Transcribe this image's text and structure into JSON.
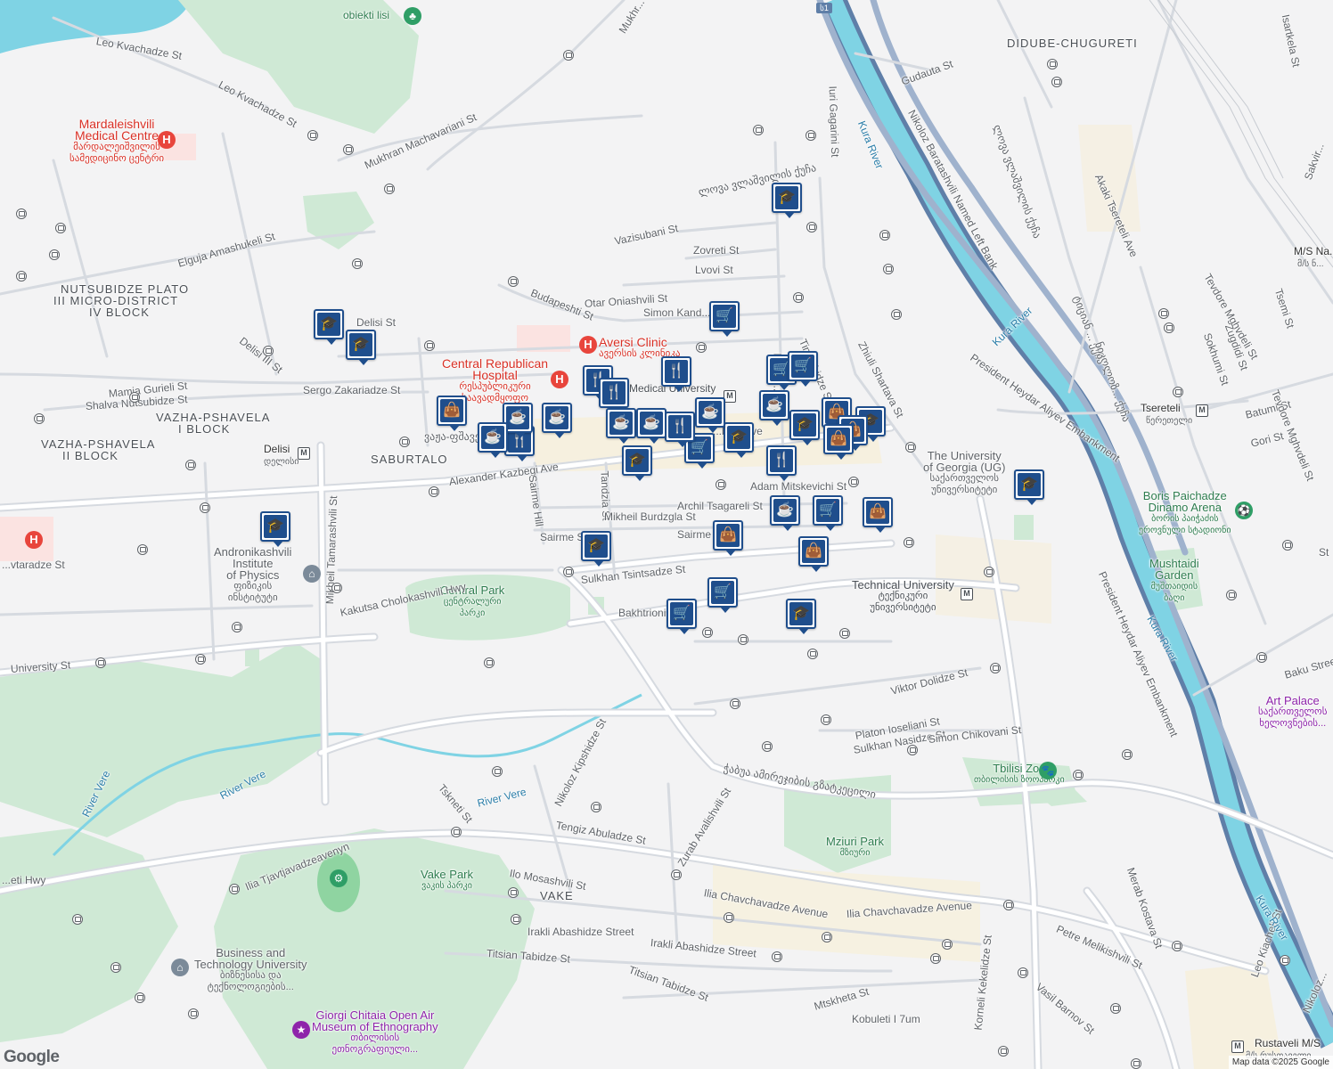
{
  "map": {
    "attribution": "Map data ©2025 Google",
    "logo": "Google",
    "colors": {
      "background": "#f3f3f4",
      "road": "#ffffff",
      "road_outline": "#d6dae0",
      "park": "#cfe9d5",
      "river": "#7fd3e4",
      "highway": "#8ea5c4",
      "pin": "#1f4e8c",
      "hospital": "#e8453c",
      "zoo": "#2f9e66"
    },
    "districts": [
      {
        "id": "didube",
        "text": "DIDUBE-CHUGURETI"
      },
      {
        "id": "nutsubidze1",
        "text": "NUTSUBIDZE PLATO"
      },
      {
        "id": "nutsubidze2",
        "text": "III MICRO-DISTRICT"
      },
      {
        "id": "nutsubidze3",
        "text": "IV BLOCK"
      },
      {
        "id": "vazha1a",
        "text": "VAZHA-PSHAVELA"
      },
      {
        "id": "vazha1b",
        "text": "I BLOCK"
      },
      {
        "id": "vazha2a",
        "text": "VAZHA-PSHAVELA"
      },
      {
        "id": "vazha2b",
        "text": "II BLOCK"
      },
      {
        "id": "saburtalo",
        "text": "SABURTALO"
      },
      {
        "id": "vake",
        "text": "VAKE"
      }
    ],
    "places": {
      "mardaleishvili": {
        "name": "Mardaleishvili",
        "name2": "Medical Centre",
        "local": "მარდალეიშვილის",
        "local2": "სამედიცინო ცენტრი"
      },
      "aversi": {
        "name": "Aversi Clinic",
        "local": "ავერსის კლინიკა"
      },
      "central_republican": {
        "name": "Central Republican",
        "name2": "Hospital",
        "local": "რესპუბლიკური",
        "local2": "საავადმყოფო"
      },
      "andronikashvili": {
        "name": "Andronikashvili",
        "name2": "Institute",
        "name3": "of Physics",
        "local": "ფიზიკის",
        "local2": "ინსტიტუტი"
      },
      "central_park": {
        "name": "Central Park",
        "local": "ცენტრალური",
        "local2": "პარკი"
      },
      "technical_university": {
        "name": "Technical University",
        "local": "ტექნიკური",
        "local2": "უნივერსიტეტი"
      },
      "university_georgia": {
        "name": "The University",
        "name2": "of Georgia (UG)",
        "local": "საქართველოს",
        "local2": "უნივერსიტეტი"
      },
      "dinamo": {
        "name": "Boris Paichadze",
        "name2": "Dinamo Arena",
        "local": "ბორის პაიჭაძის",
        "local2": "ეროვნული სტადიონი"
      },
      "mushtaidi": {
        "name": "Mushtaidi",
        "name2": "Garden",
        "local": "მუშთაიდის",
        "local2": "ბაღი"
      },
      "art_palace": {
        "name": "Art Palace",
        "local": "საქართველოს",
        "local2": "ხელოვნების..."
      },
      "zoo": {
        "name": "Tbilisi Zoo",
        "local": "თბილისის ზოოპარკი"
      },
      "mziuri": {
        "name": "Mziuri Park",
        "local": "მზიური"
      },
      "vake_park": {
        "name": "Vake Park",
        "local": "ვაკის პარკი"
      },
      "business_tech": {
        "name": "Business and",
        "name2": "Technology University",
        "local": "ბიზნესისა და",
        "local2": "ტექნოლოგიების..."
      },
      "chitaia": {
        "name": "Giorgi Chitaia Open Air",
        "name2": "Museum of Ethnography",
        "local": "თბილისის",
        "local2": "ეთნოგრაფიული..."
      },
      "obiekti": {
        "name": "obiekti lisi"
      },
      "medical_uni": {
        "name": "Medical University",
        "local": "სამედიცინო",
        "local2": "უნივერსიტეტი"
      }
    },
    "streets": {
      "leo_kvachadze_1": "Leo Kvachadze St",
      "leo_kvachadze_2": "Leo Kvachadze St",
      "mukhrani": "Mukhr...",
      "machavariani": "Mukhran Machavariani St",
      "amashukeli": "Elguja Amashukeli St",
      "delisi": "Delisi St",
      "delisi3": "Delisi III St",
      "mamia": "Mamia Gurieli St",
      "shalva": "Shalva Nutsubidze St",
      "sergo": "Sergo Zakariadze St",
      "budapeshti": "Budapeshti St",
      "otar": "Otar Oniashvili St",
      "vazisubani": "Vazisubani St",
      "zovreti": "Zovreti St",
      "lvovi": "Lvovi St",
      "simon": "Simon Kand...",
      "pekini": "Pekini...",
      "gagarini": "Iuri Gagarini St",
      "gudauta": "Gudauta St",
      "zhiuli": "Zhiuli Shartava St",
      "tin": "Tin...ebidze St",
      "kazbegi": "Alexander Kazbegi Ave",
      "kazbegi2": "...begi Ave",
      "vazha_ave": "ვაჟა-ფშაველა...",
      "tandzia": "Tandzia St",
      "sairme_hill": "Sairme Hill",
      "archil": "Archil Tsagareli St",
      "mitskevichi": "Adam Mitskevichi St",
      "burdzgla": "Mikheil Burdzgla St",
      "sairme1": "Sairme St",
      "sairme2": "Sairme S...",
      "tsintsadze": "Sulkhan Tsintsadze St",
      "bakhtrioni": "Bakhtrioni...",
      "chokoshvili": "Kakutsa Cholokashvili Hwy",
      "tamarashvili": "Mikheil Tamarashvili St",
      "university": "University St",
      "tvtaradze": "...vtaradze St",
      "dolidze": "Viktor Dolidze St",
      "ioseliani": "Platon Ioseliani St",
      "nasidze": "Sulkhan Nasidze St",
      "chikovani": "Simon Chikovani St",
      "amirejibi": "ჭაბუა ამირეჯიბის გზატკეცილი",
      "kipshidze": "Nikoloz Kipshidze St",
      "tskneti": "Tskneti St",
      "abuladze": "Tengiz Abuladze St",
      "avalishvili": "Zurab Avalishvili St",
      "tjavjavadze": "Ilia Tjavtjavadzeavenyn",
      "mosashvili": "Ilo Mosashvili St",
      "chavchavadze1": "Ilia Chavchavadze Avenue",
      "chavchavadze2": "Ilia Chavchavadze Avenue",
      "abashidze1": "Irakli Abashidze Street",
      "abashidze2": "Irakli Abashidze Street",
      "titsian1": "Titsian Tabidze St",
      "titsian2": "Titsian Tabidze St",
      "mtskheta": "Mtskheta St",
      "kobuleti": "Kobuleti I 7um",
      "kekelidze": "Korneli Kekelidze St",
      "barnov": "Vasil Barnov St",
      "melikishvili": "Petre Melikishvili St",
      "kostava": "Merab Kostava St",
      "kiacheli": "Leo Kiacheli St",
      "rustaveli": "Rustaveli M/S",
      "rustaveli_local": "მ/ს რუსთაველი",
      "left_bank": "Nikoloz Baratashvili Named Left Bank",
      "aliyev1": "President Heydar Aliyev Embankment",
      "aliyev2": "President Heydar Aliyev Embankment",
      "nikoloz_right": "Nikoloz...",
      "tsereteli_ave": "Akaki Tsereteli Ave",
      "tsereteli": "Tsereteli",
      "tsereteli_local": "წერეთელი",
      "delisi_metro": "Delisi",
      "delisi_metro_local": "დელისი",
      "batumi": "Batumi St",
      "gori": "Gori St",
      "tevdore1": "Tevdore Mghvdeli St",
      "tevdore2": "Tevdore Mghvdeli St",
      "tsemi": "Tsemi St",
      "zugdidi": "Zugdidi St",
      "sokhumi": "Sokhumi St",
      "baku": "Baku Street",
      "sakvire": "Sakvir...",
      "isartkela": "Isartkela St",
      "ms_na": "M/S Na...",
      "ms_na_local": "მ/ს ნ...",
      "geo_street1": "ლოვა ვლაშვილის ქუჩა",
      "geo_street2": "ლოვა ვლაშვილის ქუჩა",
      "geo_street3": "ტიციან ... ქუჩა",
      "geo_street4": "ნიკოლოზ... ქუჩა",
      "river_hwy": "...eti Hwy",
      "st_right": "St"
    },
    "rivers": {
      "kura1": "Kura River",
      "kura2": "Kura River",
      "kura3": "Kura River",
      "kura4": "Kura River",
      "vere1": "River Vere",
      "vere2": "River Vere",
      "vere3": "River Vere"
    },
    "highway_shield": "ს1",
    "hospital_glyph": "H",
    "metro_glyph": "M",
    "pins": [
      {
        "icon": "graduation-cap-icon",
        "glyph": "🎓"
      },
      {
        "icon": "graduation-cap-icon",
        "glyph": "🎓"
      },
      {
        "icon": "graduation-cap-icon",
        "glyph": "🎓"
      },
      {
        "icon": "graduation-cap-icon",
        "glyph": "🎓"
      },
      {
        "icon": "graduation-cap-icon",
        "glyph": "🎓"
      },
      {
        "icon": "graduation-cap-icon",
        "glyph": "🎓"
      },
      {
        "icon": "graduation-cap-icon",
        "glyph": "🎓"
      },
      {
        "icon": "graduation-cap-icon",
        "glyph": "🎓"
      },
      {
        "icon": "graduation-cap-icon",
        "glyph": "🎓"
      },
      {
        "icon": "graduation-cap-icon",
        "glyph": "🎓"
      },
      {
        "icon": "graduation-cap-icon",
        "glyph": "🎓"
      },
      {
        "icon": "shopping-cart-icon",
        "glyph": "🛒"
      },
      {
        "icon": "shopping-cart-icon",
        "glyph": "🛒"
      },
      {
        "icon": "shopping-cart-icon",
        "glyph": "🛒"
      },
      {
        "icon": "shopping-cart-icon",
        "glyph": "🛒"
      },
      {
        "icon": "shopping-cart-icon",
        "glyph": "🛒"
      },
      {
        "icon": "shopping-cart-icon",
        "glyph": "🛒"
      },
      {
        "icon": "shopping-cart-icon",
        "glyph": "🛒"
      },
      {
        "icon": "cutlery-icon",
        "glyph": "🍴"
      },
      {
        "icon": "cutlery-icon",
        "glyph": "🍴"
      },
      {
        "icon": "cutlery-icon",
        "glyph": "🍴"
      },
      {
        "icon": "cutlery-icon",
        "glyph": "🍴"
      },
      {
        "icon": "cutlery-icon",
        "glyph": "🍴"
      },
      {
        "icon": "cutlery-icon",
        "glyph": "🍴"
      },
      {
        "icon": "coffee-cup-icon",
        "glyph": "☕"
      },
      {
        "icon": "coffee-cup-icon",
        "glyph": "☕"
      },
      {
        "icon": "coffee-cup-icon",
        "glyph": "☕"
      },
      {
        "icon": "coffee-cup-icon",
        "glyph": "☕"
      },
      {
        "icon": "coffee-cup-icon",
        "glyph": "☕"
      },
      {
        "icon": "coffee-cup-icon",
        "glyph": "☕"
      },
      {
        "icon": "coffee-cup-icon",
        "glyph": "☕"
      },
      {
        "icon": "coffee-cup-icon",
        "glyph": "☕"
      },
      {
        "icon": "shopping-bag-icon",
        "glyph": "👜"
      },
      {
        "icon": "shopping-bag-icon",
        "glyph": "👜"
      },
      {
        "icon": "shopping-bag-icon",
        "glyph": "👜"
      },
      {
        "icon": "shopping-bag-icon",
        "glyph": "👜"
      },
      {
        "icon": "shopping-bag-icon",
        "glyph": "👜"
      },
      {
        "icon": "shopping-bag-icon",
        "glyph": "👜"
      },
      {
        "icon": "shopping-bag-icon",
        "glyph": "👜"
      }
    ]
  }
}
